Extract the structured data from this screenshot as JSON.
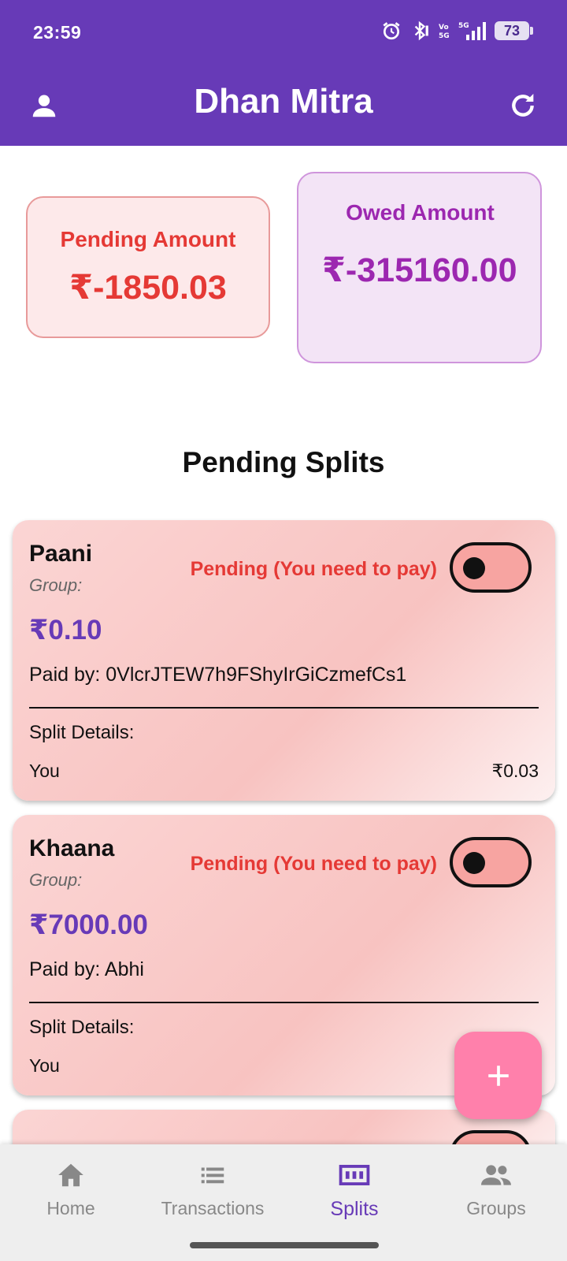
{
  "status_bar": {
    "time": "23:59",
    "icons": [
      "alarm-icon",
      "bluetooth-icon",
      "volte-icon",
      "signal-5g-icon"
    ],
    "battery": "73"
  },
  "app_bar": {
    "title": "Dhan Mitra",
    "left_icon": "person-icon",
    "right_icon": "refresh-icon"
  },
  "summary": {
    "pending": {
      "label": "Pending Amount",
      "amount": "₹-1850.03"
    },
    "owed": {
      "label": "Owed Amount",
      "amount": "₹-315160.00"
    }
  },
  "section_title": "Pending Splits",
  "splits": [
    {
      "name": "Paani",
      "group": "Group:",
      "status": "Pending (You need to pay)",
      "amount": "₹0.10",
      "paid_by": "Paid by: 0VlcrJTEW7h9FShyIrGiCzmefCs1",
      "details_label": "Split Details:",
      "rows": [
        {
          "name": "You",
          "amount": "₹0.03"
        }
      ]
    },
    {
      "name": "Khaana",
      "group": "Group:",
      "status": "Pending (You need to pay)",
      "amount": "₹7000.00",
      "paid_by": "Paid by: Abhi",
      "details_label": "Split Details:",
      "rows": [
        {
          "name": "You",
          "amount": ""
        }
      ]
    }
  ],
  "fab": {
    "icon": "plus-icon"
  },
  "bottom_nav": {
    "items": [
      {
        "label": "Home",
        "icon": "home-icon",
        "active": false
      },
      {
        "label": "Transactions",
        "icon": "list-icon",
        "active": false
      },
      {
        "label": "Splits",
        "icon": "splits-icon",
        "active": true
      },
      {
        "label": "Groups",
        "icon": "groups-icon",
        "active": false
      }
    ]
  },
  "colors": {
    "primary": "#673ab7",
    "pending_red": "#e53935",
    "owed_purple": "#9c27b0",
    "fab_pink": "#ff80ab"
  }
}
